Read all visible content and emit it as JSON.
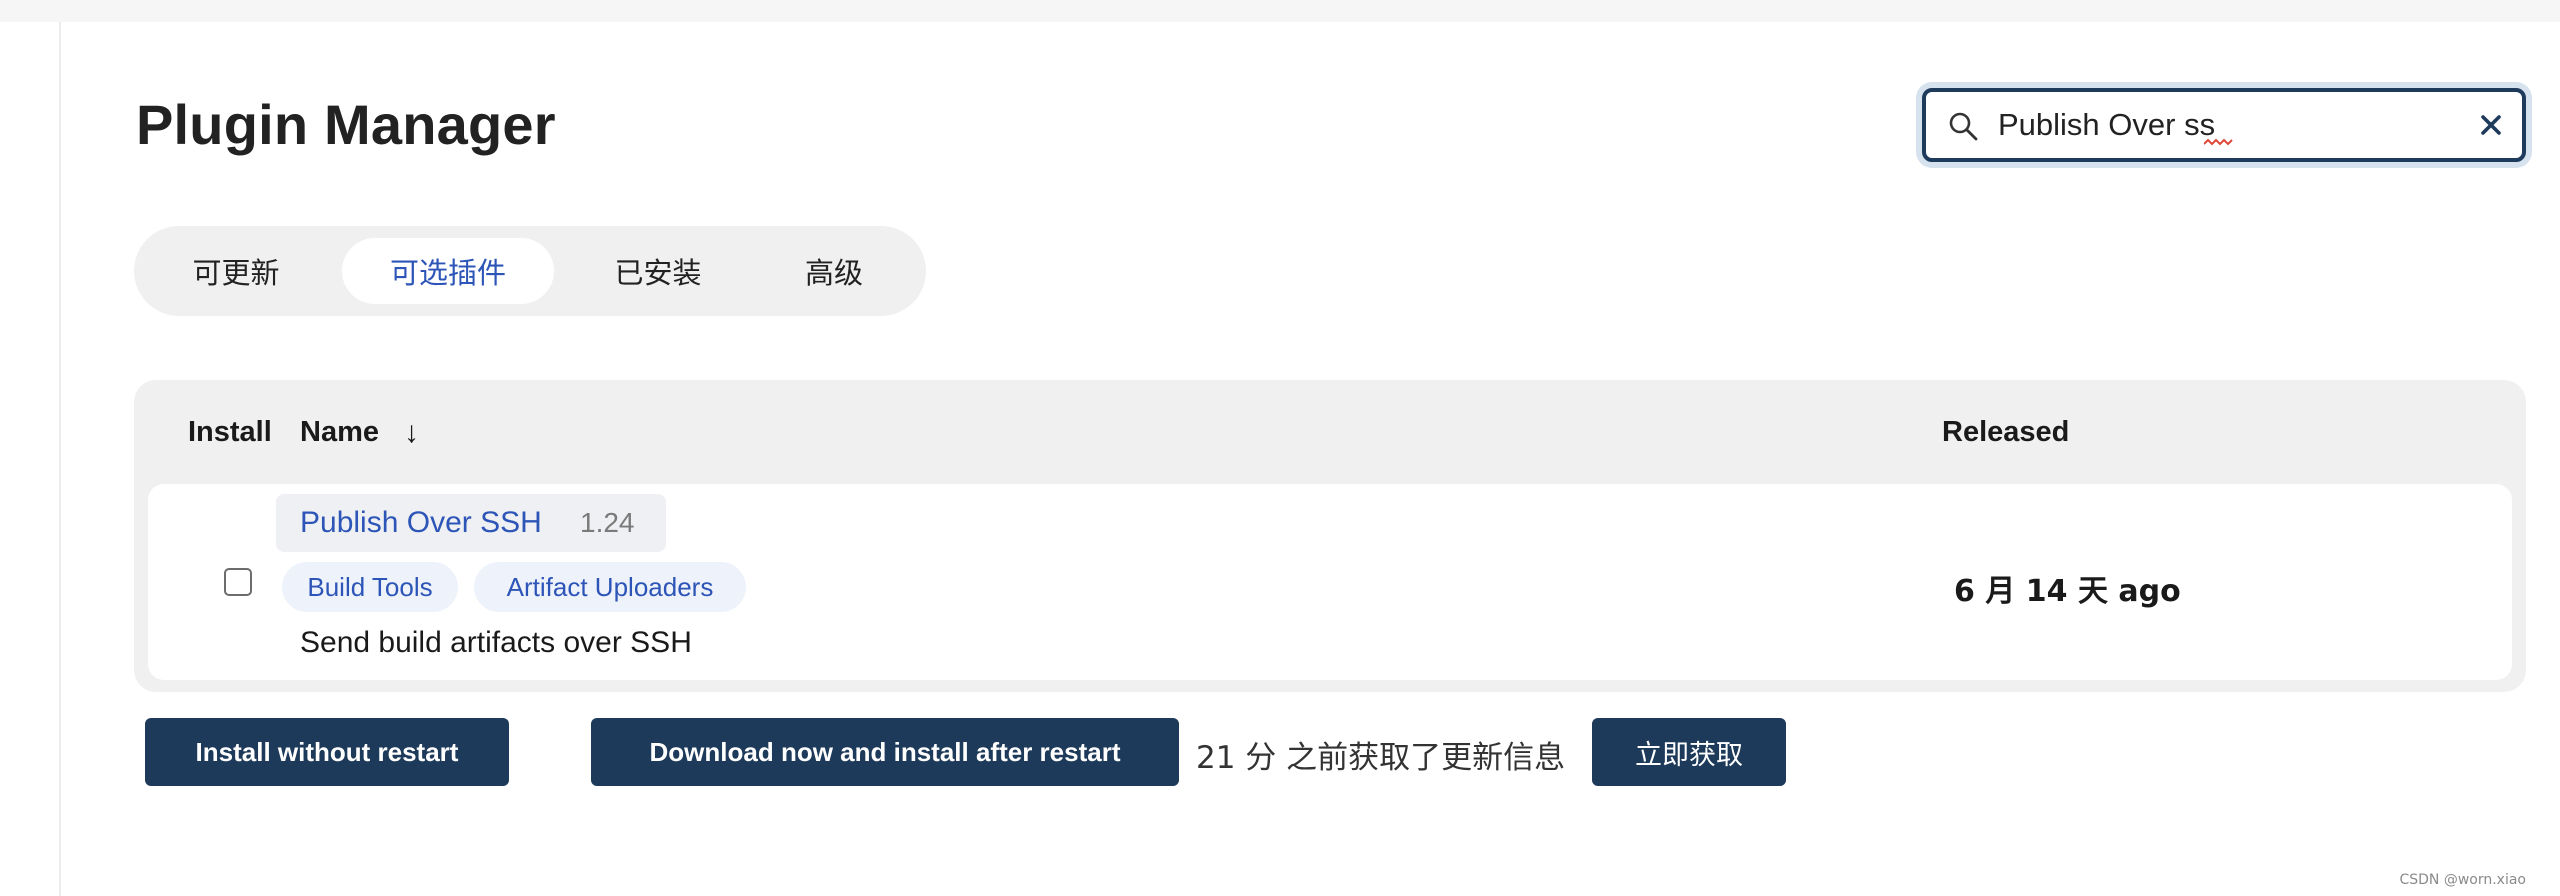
{
  "page": {
    "title": "Plugin Manager"
  },
  "search": {
    "value": "Publish Over ss",
    "icon": "search-icon",
    "clear_icon": "close-icon"
  },
  "tabs": [
    {
      "label": "可更新",
      "active": false
    },
    {
      "label": "可选插件",
      "active": true
    },
    {
      "label": "已安装",
      "active": false
    },
    {
      "label": "高级",
      "active": false
    }
  ],
  "table": {
    "headers": {
      "install": "Install",
      "name": "Name",
      "name_sort_icon": "↓",
      "released": "Released"
    },
    "rows": [
      {
        "checked": false,
        "name": "Publish Over SSH",
        "version": "1.24",
        "tags": [
          "Build Tools",
          "Artifact Uploaders"
        ],
        "description": "Send build artifacts over SSH",
        "released": "6 月 14 天 ago"
      }
    ]
  },
  "actions": {
    "install_without_restart": "Install without restart",
    "download_install_after_restart": "Download now and install after restart",
    "update_info": "21 分 之前获取了更新信息",
    "fetch_now": "立即获取"
  },
  "watermark": "CSDN @worn.xiao",
  "colors": {
    "accent": "#2d55b7",
    "button_bg": "#1e3a5a",
    "search_border": "#1f3b5c"
  }
}
